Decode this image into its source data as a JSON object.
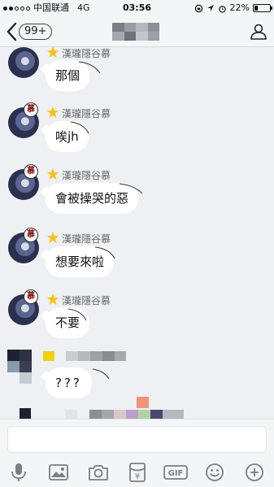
{
  "status_bar": {
    "carrier": "中国联通",
    "network": "4G",
    "time": "03:56",
    "battery": "22%",
    "battery_level": 0.22
  },
  "header": {
    "unread_count": "99+"
  },
  "messages": [
    {
      "sender": "漢瓏隱谷慕",
      "text": "那個"
    },
    {
      "sender": "漢瓏隱谷慕",
      "text": "唉jh"
    },
    {
      "sender": "漢瓏隱谷慕",
      "text": "會被操哭的惡"
    },
    {
      "sender": "漢瓏隱谷慕",
      "text": "想要來啦"
    },
    {
      "sender": "漢瓏隱谷慕",
      "text": "不要"
    },
    {
      "sender": "",
      "text": "???"
    }
  ],
  "avatar_tag": "慕",
  "input": {
    "value": "",
    "placeholder": ""
  },
  "toolbar": {
    "icons": [
      "microphone-icon",
      "image-icon",
      "camera-icon",
      "red-packet-icon",
      "gif-icon",
      "emoji-icon",
      "plus-icon"
    ],
    "red_packet_label": "¥",
    "gif_label": "GIF"
  },
  "colors": {
    "background": "#eef0f3",
    "bubble": "#ffffff",
    "star": "#f6c21a",
    "icon": "#7a7f87"
  }
}
